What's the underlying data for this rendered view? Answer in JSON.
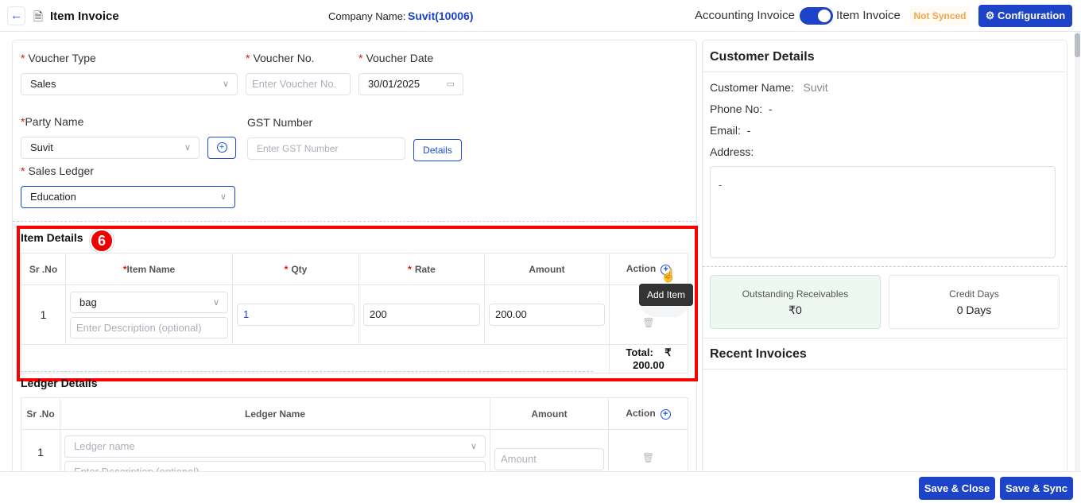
{
  "header": {
    "title": "Item Invoice",
    "company_label": "Company Name:",
    "company_value": "Suvit(10006)",
    "toggle_left": "Accounting Invoice",
    "toggle_right": "Item Invoice",
    "toggle_on": true,
    "sync_status": "Not Synced",
    "config_label": "Configuration"
  },
  "form": {
    "voucher_type_label": "Voucher Type",
    "voucher_type_value": "Sales",
    "voucher_no_label": "Voucher No.",
    "voucher_no_placeholder": "Enter  Voucher No.",
    "voucher_date_label": "Voucher Date",
    "voucher_date_value": "30/01/2025",
    "party_label": "Party Name",
    "party_value": "Suvit",
    "gst_label": "GST Number",
    "gst_placeholder": "Enter GST Number",
    "details_label": "Details",
    "ledger_label": "Sales Ledger",
    "ledger_value": "Education"
  },
  "items": {
    "title": "Item Details",
    "step_badge": "6",
    "headers": [
      "Sr .No",
      "Item Name",
      "Qty",
      "Rate",
      "Amount",
      "Action"
    ],
    "rows": [
      {
        "sr": "1",
        "item": "bag",
        "desc_placeholder": "Enter Description (optional)",
        "qty": "1",
        "rate": "200",
        "amount": "200.00"
      }
    ],
    "total_label": "Total:",
    "total_value": "₹ 200.00",
    "tooltip": "Add Item"
  },
  "ledgers": {
    "title": "Ledger Details",
    "headers": [
      "Sr .No",
      "Ledger Name",
      "Amount",
      "Action"
    ],
    "rows": [
      {
        "sr": "1",
        "ledger_placeholder": "Ledger name",
        "desc_placeholder": "Enter Description (optional)",
        "amount_placeholder": "Amount"
      }
    ]
  },
  "customer": {
    "title": "Customer Details",
    "name_label": "Customer Name:",
    "name_value": "Suvit",
    "phone_label": "Phone No:",
    "phone_value": "-",
    "email_label": "Email:",
    "email_value": "-",
    "address_label": "Address:",
    "address_value": "-",
    "receivables_label": "Outstanding Receivables",
    "receivables_value": "₹0",
    "credit_label": "Credit Days",
    "credit_value": "0 Days",
    "recent_title": "Recent Invoices"
  },
  "footer": {
    "save_close": "Save & Close",
    "save_sync": "Save & Sync"
  },
  "colors": {
    "primary": "#1d44c8",
    "highlight": "#ff0000",
    "warning": "#f5a54a"
  }
}
